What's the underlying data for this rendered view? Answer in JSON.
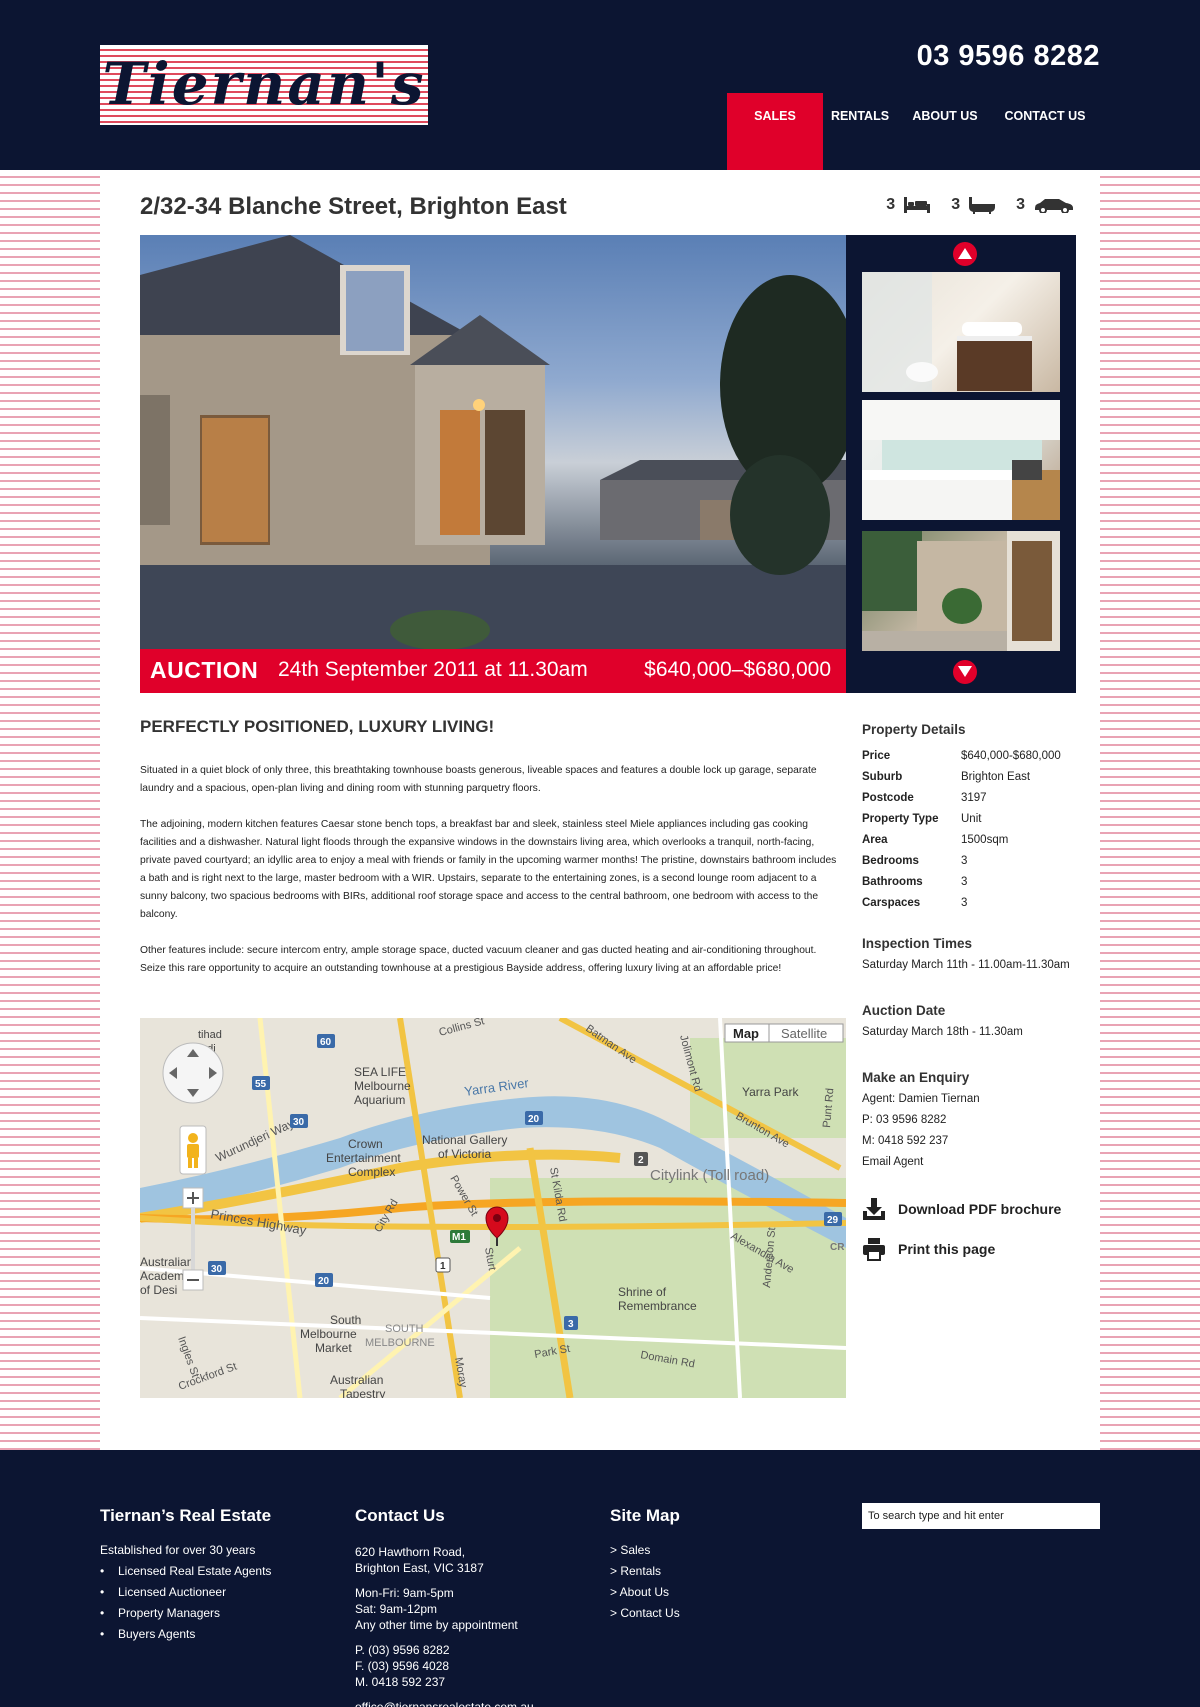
{
  "header": {
    "logo_text": "Tiernan's",
    "phone": "03 9596 8282",
    "nav": [
      {
        "label": "SALES",
        "active": true
      },
      {
        "label": "RENTALS"
      },
      {
        "label": "ABOUT US"
      },
      {
        "label": "CONTACT US"
      }
    ]
  },
  "listing": {
    "address": "2/32-34 Blanche Street, Brighton East",
    "bedrooms": "3",
    "bathrooms": "3",
    "carspaces": "3",
    "auction_label": "AUCTION",
    "auction_date": "24th September 2011 at 11.30am",
    "price_range": "$640,000–$680,000",
    "headline": "PERFECTLY POSITIONED, LUXURY LIVING!",
    "description": [
      "Situated in a quiet block of only three, this breathtaking townhouse boasts generous, liveable spaces and features a double lock up garage, separate laundry and a spacious, open-plan living and dining room with stunning parquetry floors.",
      "The adjoining, modern kitchen features Caesar stone bench tops, a breakfast bar and sleek, stainless steel Miele appliances including gas cooking facilities and a dishwasher. Natural light floods through the expansive windows in the downstairs living area, which overlooks a tranquil, north-facing, private paved courtyard; an idyllic area to enjoy a meal with friends or family in the upcoming warmer months! The pristine, downstairs bathroom includes a bath and is right next to the large, master bedroom with a WIR. Upstairs, separate to the entertaining zones, is a second lounge room adjacent to a sunny balcony, two spacious bedrooms with BIRs, additional roof storage space and access to the central bathroom, one bedroom with access to the balcony.",
      "Other features include: secure intercom entry, ample storage space, ducted vacuum cleaner and gas ducted heating and air-conditioning throughout. Seize this rare opportunity to acquire an outstanding townhouse at a prestigious Bayside address, offering luxury living at an affordable price!"
    ]
  },
  "map": {
    "map_button": "Map",
    "satellite_button": "Satellite",
    "labels": {
      "collins": "Collins St",
      "sealife": "SEA LIFE",
      "melbourne": "Melbourne",
      "aquarium": "Aquarium",
      "yarra": "Yarra River",
      "crown": "Crown",
      "entertainment": "Entertainment",
      "complex": "Complex",
      "ngv1": "National Gallery",
      "ngv2": "of Victoria",
      "citylink": "Citylink (Toll road)",
      "yarrapark": "Yarra Park",
      "brunton": "Brunton Ave",
      "jolimont": "Jolimont Rd",
      "batman": "Batman Ave",
      "wurundjeri": "Wurundjeri Way",
      "princes": "Princes Highway",
      "cityrd": "City Rd",
      "powerst": "Power St",
      "stkilda": "St Kilda Rd",
      "alexandra": "Alexandra Ave",
      "shrine1": "Shrine of",
      "shrine2": "Remembrance",
      "sm1": "South",
      "sm2": "Melbourne",
      "sm3": "Market",
      "smel": "SOUTH",
      "smel2": "MELBOURNE",
      "parkst": "Park St",
      "domain": "Domain Rd",
      "anderson": "Anderson St",
      "ingles": "Ingles St",
      "crockford": "Crockford St",
      "tapestry1": "Australian",
      "tapestry2": "Tapestry",
      "acad1": "Australian",
      "acad2": "Academy",
      "acad3": "of Desi",
      "etihad1": "tihad",
      "etihad2": "tadi",
      "sturt": "Sturt",
      "moray": "Moray",
      "hoddle": "Punt Rd",
      "r60": "60",
      "r55": "55",
      "r30a": "30",
      "r30b": "30",
      "r20a": "20",
      "r20b": "20",
      "r3": "3",
      "r1": "1",
      "r2": "2",
      "r29": "29",
      "m1": "M1",
      "cr": "CR"
    }
  },
  "property_details": {
    "heading": "Property Details",
    "rows": [
      {
        "label": "Price",
        "value": "$640,000-$680,000"
      },
      {
        "label": "Suburb",
        "value": "Brighton East"
      },
      {
        "label": "Postcode",
        "value": "3197"
      },
      {
        "label": "Property Type",
        "value": "Unit"
      },
      {
        "label": "Area",
        "value": "1500sqm"
      },
      {
        "label": "Bedrooms",
        "value": "3"
      },
      {
        "label": "Bathrooms",
        "value": "3"
      },
      {
        "label": "Carspaces",
        "value": "3"
      }
    ]
  },
  "inspection": {
    "heading": "Inspection Times",
    "text": "Saturday March 11th - 11.00am-11.30am"
  },
  "auction_date": {
    "heading": "Auction Date",
    "text": "Saturday March 18th - 11.30am"
  },
  "enquiry": {
    "heading": "Make an Enquiry",
    "agent": "Agent: Damien Tiernan",
    "phone": "P: 03 9596 8282",
    "mobile": "M: 0418 592 237",
    "email": "Email Agent"
  },
  "actions": {
    "download": "Download PDF brochure",
    "print": "Print this page"
  },
  "footer": {
    "col1": {
      "heading": "Tiernan’s Real Estate",
      "intro": "Established for over 30 years",
      "items": [
        "Licensed Real Estate Agents",
        "Licensed Auctioneer",
        "Property Managers",
        "Buyers Agents"
      ]
    },
    "col2": {
      "heading": "Contact Us",
      "addr1": "620 Hawthorn Road,",
      "addr2": "Brighton East, VIC 3187",
      "hours1": "Mon-Fri: 9am-5pm",
      "hours2": "Sat: 9am-12pm",
      "hours3": "Any other time by appointment",
      "p": "P. (03) 9596 8282",
      "f": "F. (03) 9596 4028",
      "m": "M. 0418 592 237",
      "email": "office@tiernansrealestate.com.au"
    },
    "col3": {
      "heading": "Site Map",
      "links": [
        "> Sales",
        "> Rentals",
        "> About Us",
        "> Contact Us"
      ]
    },
    "search_placeholder": "To search type and hit enter"
  },
  "colors": {
    "navy": "#0c1532",
    "red": "#e0002a",
    "stripe": "#e9a3b4"
  }
}
